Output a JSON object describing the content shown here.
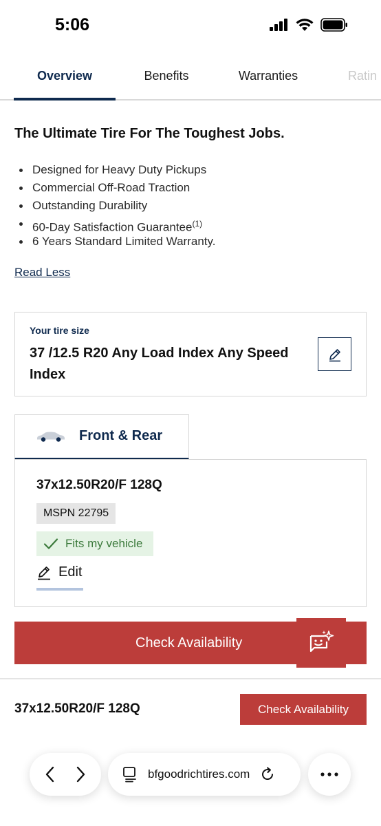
{
  "status_bar": {
    "time": "5:06"
  },
  "tabs": [
    {
      "label": "Overview"
    },
    {
      "label": "Benefits"
    },
    {
      "label": "Warranties"
    },
    {
      "label": "Ratin"
    }
  ],
  "intro": {
    "headline": "The Ultimate Tire For The Toughest Jobs.",
    "features": [
      "Designed for Heavy Duty Pickups",
      "Commercial Off-Road Traction",
      "Outstanding Durability",
      "60-Day Satisfaction Guarantee",
      "6 Years Standard Limited Warranty."
    ],
    "guarantee_footnote": "(1)",
    "read_less": "Read Less"
  },
  "tire_size": {
    "label": "Your tire size",
    "value": "37 /12.5 R20 Any Load Index Any Speed Index"
  },
  "position_tab": {
    "label": "Front & Rear"
  },
  "product": {
    "title": "37x12.50R20/F 128Q",
    "mspn": "MSPN 22795",
    "fits": "Fits my vehicle",
    "edit": "Edit"
  },
  "cta": {
    "label": "Check Availability"
  },
  "sticky": {
    "title": "37x12.50R20/F 128Q",
    "cta": "Check Availability"
  },
  "browser": {
    "url": "bfgoodrichtires.com"
  },
  "colors": {
    "navy": "#0f2a4e",
    "red": "#bc3d3a",
    "green_text": "#3c7a3c",
    "green_bg": "#e5f3e5"
  }
}
